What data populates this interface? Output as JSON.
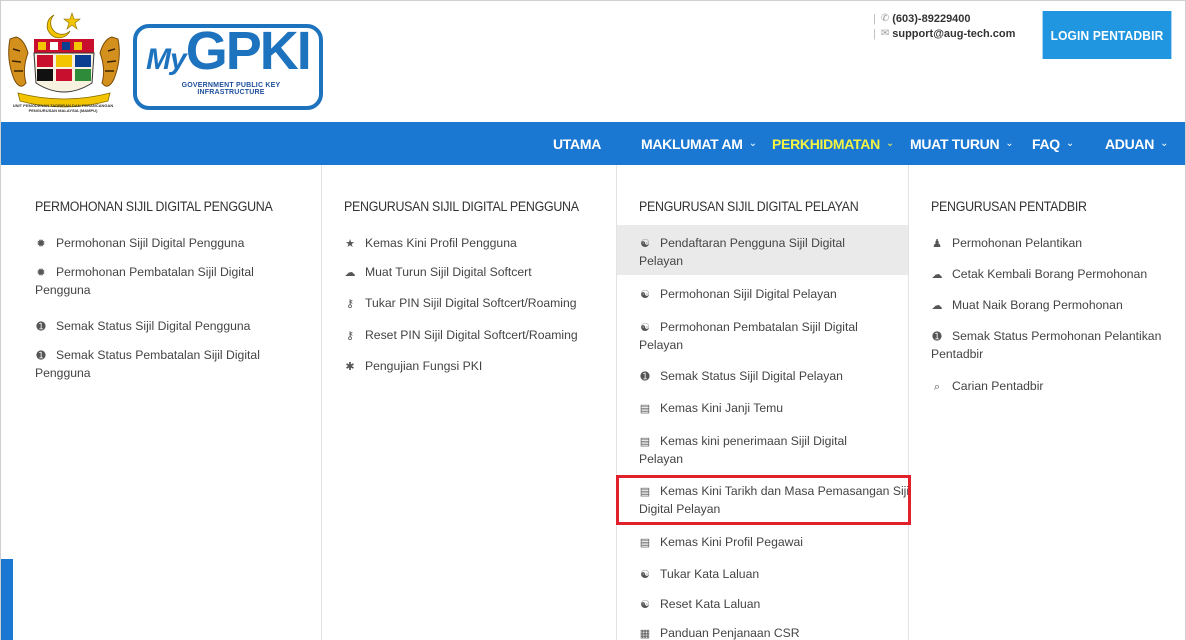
{
  "header": {
    "crest_caption": "UNIT PEMODENAN TADBIRAN DAN PERANCANGAN PENGURUSAN MALAYSIA (MAMPU)",
    "logo_my": "My",
    "logo_gpki": "GPKI",
    "logo_subtitle": "GOVERNMENT PUBLIC KEY INFRASTRUCTURE",
    "phone": "(603)-89229400",
    "email": "support@aug-tech.com",
    "login_label": "LOGIN PENTADBIR",
    "colors": {
      "brand_blue": "#1a78d2",
      "login_blue": "#2196e0"
    }
  },
  "nav": {
    "items": [
      {
        "label": "UTAMA",
        "has_dropdown": false
      },
      {
        "label": "MAKLUMAT AM",
        "has_dropdown": true
      },
      {
        "label": "PERKHIDMATAN",
        "has_dropdown": true,
        "active": true
      },
      {
        "label": "MUAT TURUN",
        "has_dropdown": true
      },
      {
        "label": "FAQ",
        "has_dropdown": true
      },
      {
        "label": "ADUAN",
        "has_dropdown": true
      }
    ],
    "chevron": "⌄",
    "active_color": "#f4f442"
  },
  "menu": {
    "columns": [
      {
        "title": "PERMOHONAN SIJIL DIGITAL PENGGUNA",
        "items": [
          {
            "icon": "gear-icon",
            "label": "Permohonan Sijil Digital Pengguna"
          },
          {
            "icon": "gear-icon",
            "label": "Permohonan Pembatalan Sijil Digital Pengguna"
          },
          {
            "icon": "info-icon",
            "label": "Semak Status Sijil Digital Pengguna"
          },
          {
            "icon": "info-icon",
            "label": "Semak Status Pembatalan Sijil Digital Pengguna"
          }
        ]
      },
      {
        "title": "PENGURUSAN SIJIL DIGITAL PENGGUNA",
        "items": [
          {
            "icon": "user-tie-icon",
            "label": "Kemas Kini Profil Pengguna"
          },
          {
            "icon": "cloud-download-icon",
            "label": "Muat Turun Sijil Digital Softcert"
          },
          {
            "icon": "key-icon",
            "label": "Tukar PIN Sijil Digital Softcert/Roaming"
          },
          {
            "icon": "key-icon",
            "label": "Reset PIN Sijil Digital Softcert/Roaming"
          },
          {
            "icon": "asterisk-icon",
            "label": "Pengujian Fungsi PKI"
          }
        ]
      },
      {
        "title": "PENGURUSAN SIJIL DIGITAL PELAYAN",
        "items": [
          {
            "icon": "globe-icon",
            "label": "Pendaftaran Pengguna Sijil Digital Pelayan"
          },
          {
            "icon": "globe-icon",
            "label": "Permohonan Sijil Digital Pelayan"
          },
          {
            "icon": "globe-icon",
            "label": "Permohonan Pembatalan Sijil Digital Pelayan"
          },
          {
            "icon": "info-icon",
            "label": "Semak Status Sijil Digital Pelayan"
          },
          {
            "icon": "list-icon",
            "label": "Kemas Kini Janji Temu"
          },
          {
            "icon": "list-icon",
            "label": "Kemas kini penerimaan Sijil Digital Pelayan"
          },
          {
            "icon": "list-icon",
            "label": "Kemas Kini Tarikh dan Masa Pemasangan Sijil Digital Pelayan"
          },
          {
            "icon": "list-icon",
            "label": "Kemas Kini Profil Pegawai"
          },
          {
            "icon": "globe-icon",
            "label": "Tukar Kata Laluan"
          },
          {
            "icon": "globe-icon",
            "label": "Reset Kata Laluan"
          },
          {
            "icon": "book-icon",
            "label": "Panduan Penjanaan CSR"
          }
        ]
      },
      {
        "title": "PENGURUSAN PENTADBIR",
        "items": [
          {
            "icon": "user-icon",
            "label": "Permohonan Pelantikan"
          },
          {
            "icon": "cloud-download-icon",
            "label": "Cetak Kembali Borang Permohonan"
          },
          {
            "icon": "cloud-upload-icon",
            "label": "Muat Naik Borang Permohonan"
          },
          {
            "icon": "info-icon",
            "label": "Semak Status Permohonan Pelantikan Pentadbir"
          },
          {
            "icon": "search-icon",
            "label": "Carian Pentadbir"
          }
        ]
      }
    ],
    "highlight_color": "#e0202a"
  }
}
